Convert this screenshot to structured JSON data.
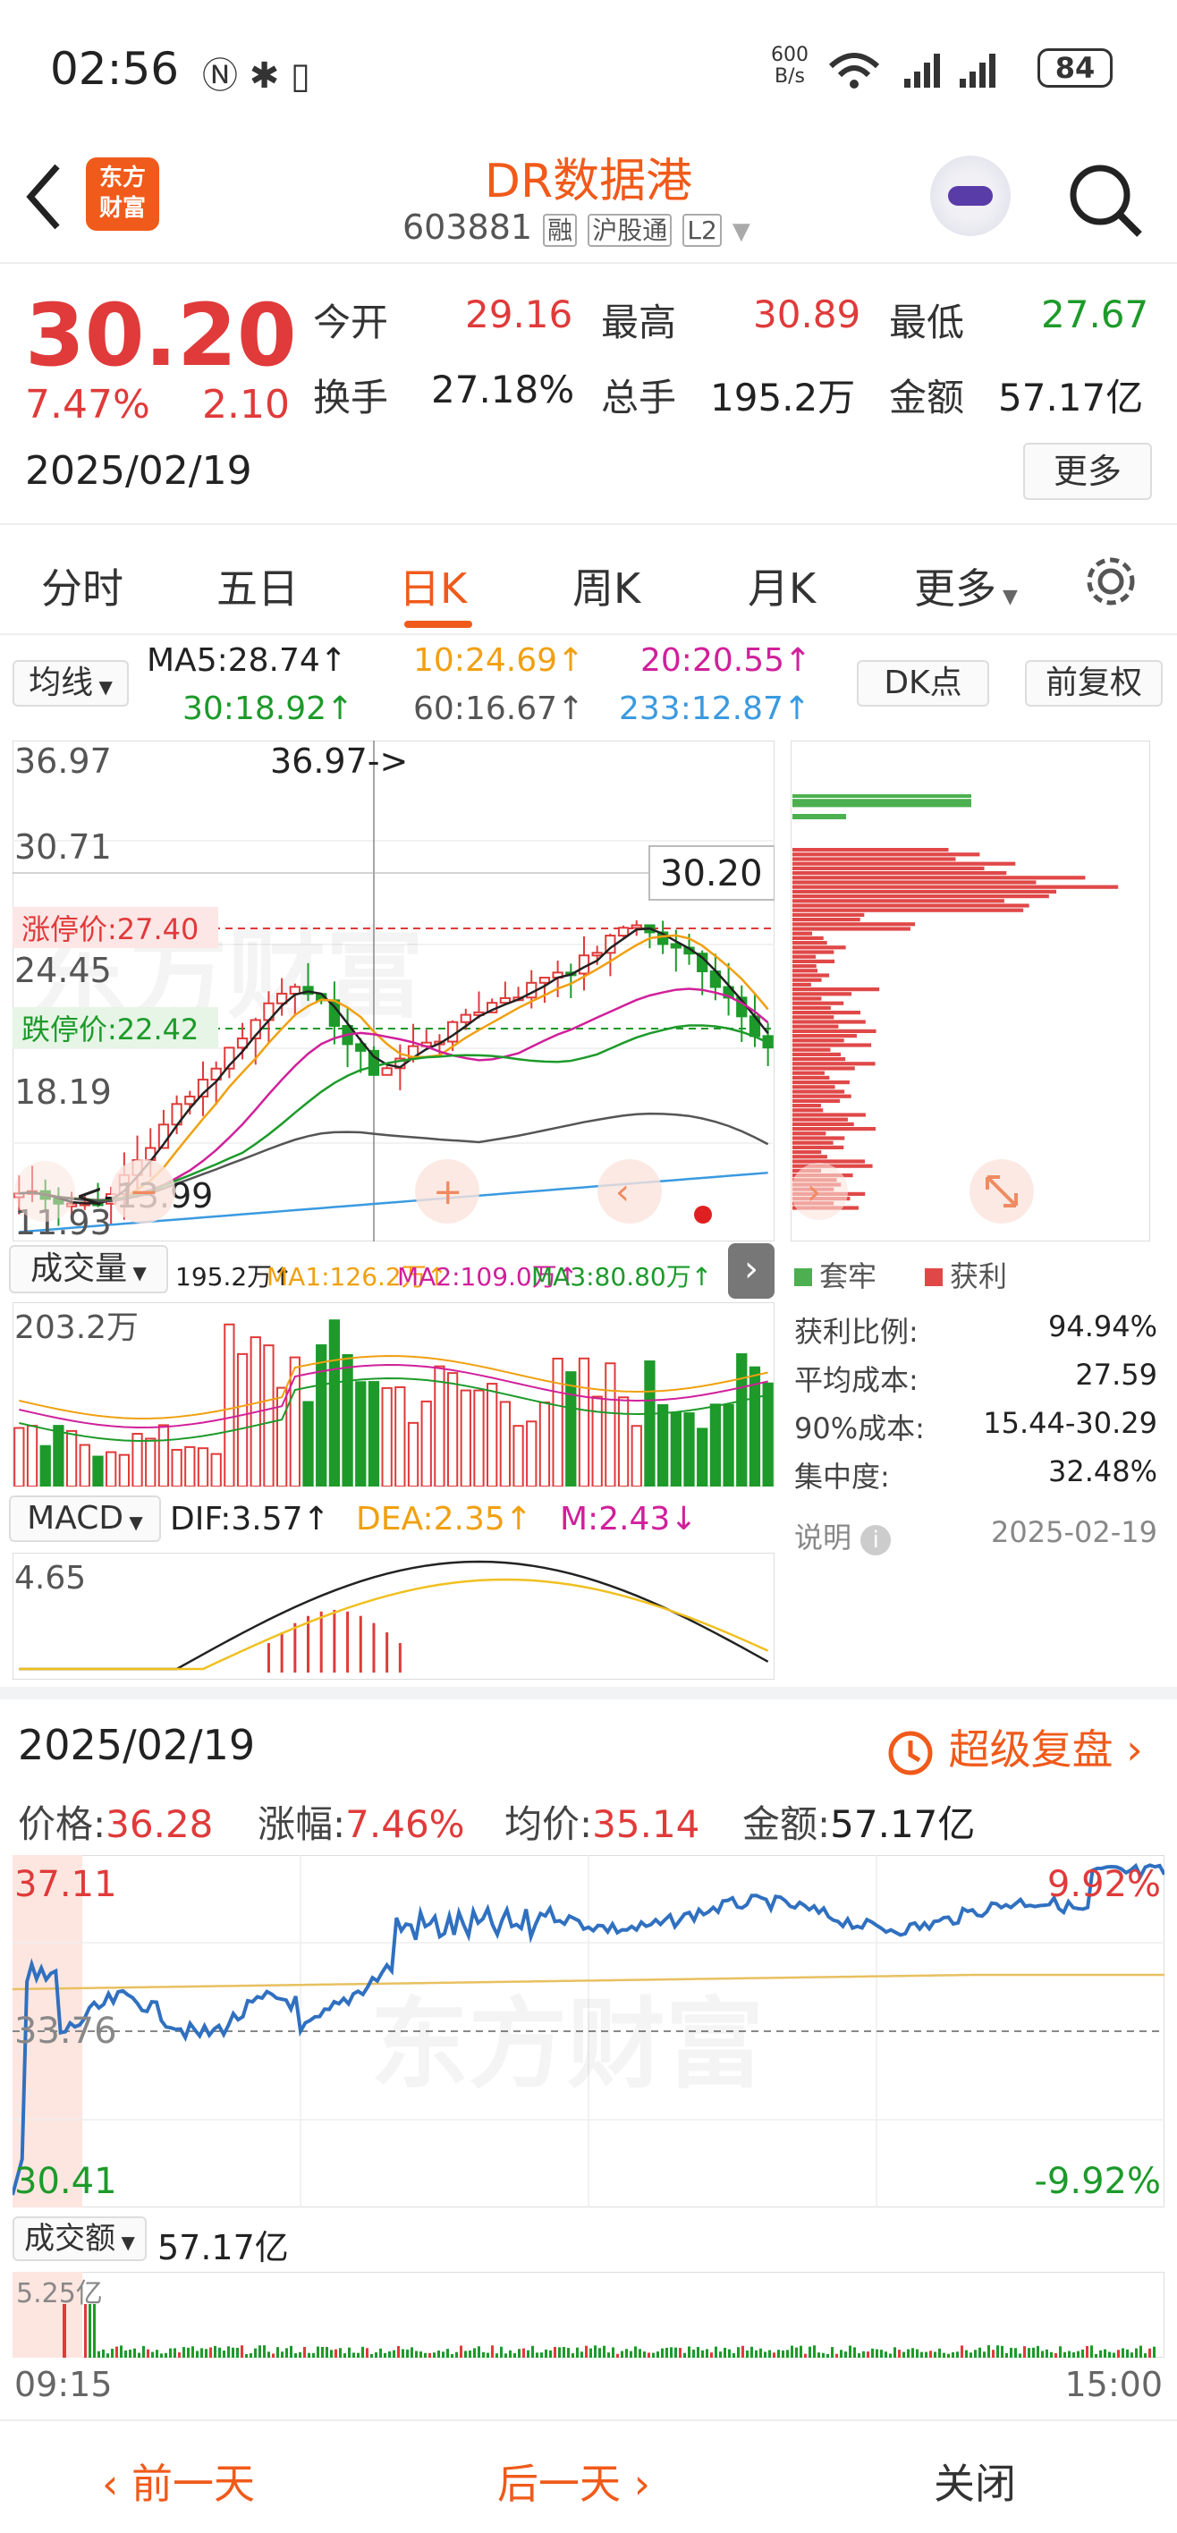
{
  "status": {
    "time": "02:56",
    "net_speed_top": "600",
    "net_speed_bottom": "B/s",
    "battery": "84"
  },
  "header": {
    "title": "DR数据港",
    "code": "603881",
    "tags": [
      "融",
      "沪股通",
      "L2"
    ],
    "logo_text_top": "东方",
    "logo_text_bottom": "财富"
  },
  "quote": {
    "price": "30.20",
    "change_pct": "7.47%",
    "change_abs": "2.10",
    "date": "2025/02/19",
    "open_label": "今开",
    "open": "29.16",
    "high_label": "最高",
    "high": "30.89",
    "low_label": "最低",
    "low": "27.67",
    "turnover_label": "换手",
    "turnover": "27.18%",
    "volume_label": "总手",
    "volume": "195.2万",
    "amount_label": "金额",
    "amount": "57.17亿",
    "more": "更多"
  },
  "tabs": [
    "分时",
    "五日",
    "日K",
    "周K",
    "月K",
    "更多"
  ],
  "active_tab": "日K",
  "ma_bar": {
    "selector": "均线",
    "ma5": "MA5:28.74↑",
    "ma10": "10:24.69↑",
    "ma20": "20:20.55↑",
    "ma30": "30:18.92↑",
    "ma60": "60:16.67↑",
    "ma233": "233:12.87↑",
    "dk": "DK点",
    "adjust": "前复权"
  },
  "kline": {
    "y_labels": [
      "36.97",
      "30.71",
      "24.45",
      "18.19",
      "11.93"
    ],
    "max_marker": "36.97->",
    "min_marker": "<-13.99",
    "limit_up": "涨停价:27.40",
    "limit_down": "跌停价:22.42",
    "last_price_tag": "30.20"
  },
  "volume_bar": {
    "selector": "成交量",
    "total": "195.2万↑",
    "ma1": "MA1:126.2万↑",
    "ma2": "MA2:109.0万↑",
    "ma3": "MA3:80.80万↑",
    "y_label": "203.2万"
  },
  "macd_bar": {
    "selector": "MACD",
    "dif": "DIF:3.57↑",
    "dea": "DEA:2.35↑",
    "m": "M:2.43↓",
    "y_label": "4.65"
  },
  "chip": {
    "legend_trap": "套牢",
    "legend_profit": "获利",
    "rows": [
      [
        "获利比例:",
        "94.94%"
      ],
      [
        "平均成本:",
        "27.59"
      ],
      [
        "90%成本:",
        "15.44-30.29"
      ],
      [
        "集中度:",
        "32.48%"
      ]
    ],
    "note_label": "说明",
    "note_date": "2025-02-19"
  },
  "intraday": {
    "date": "2025/02/19",
    "review": "超级复盘",
    "price_label": "价格:",
    "price": "36.28",
    "chg_label": "涨幅:",
    "chg": "7.46%",
    "avg_label": "均价:",
    "avg": "35.14",
    "amt_label": "金额:",
    "amt": "57.17亿",
    "y_top": "37.11",
    "y_mid": "33.76",
    "y_bottom": "30.41",
    "pct_top": "9.92%",
    "pct_bottom": "-9.92%",
    "amt_selector": "成交额",
    "amt_total": "57.17亿",
    "vol_label": "5.25亿",
    "t_start": "09:15",
    "t_end": "15:00"
  },
  "footer": {
    "prev": "前一天",
    "next": "后一天",
    "close": "关闭"
  },
  "colors": {
    "up": "#e03a3a",
    "down": "#1d9a2a",
    "accent": "#f05a1a"
  }
}
